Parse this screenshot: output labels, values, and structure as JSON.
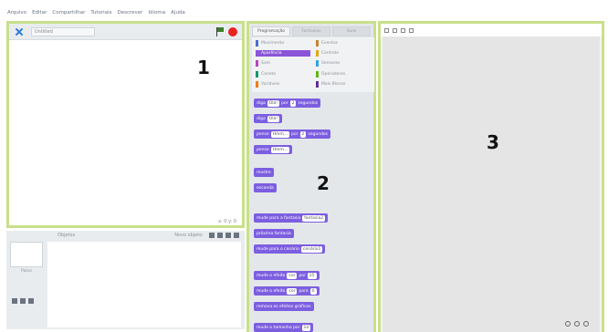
{
  "menubar": {
    "items": [
      "Arquivo",
      "Editar",
      "Compartilhar",
      "Tutoriais",
      "Descrever",
      "Idioma",
      "Ajuda"
    ]
  },
  "region_numbers": {
    "stage": "1",
    "blocks": "2",
    "scripts": "3"
  },
  "stage": {
    "project_title": "Untitled",
    "footer": "x: 0   y: 0"
  },
  "sprites": {
    "title": "Objetos",
    "new_label": "Novo objeto:",
    "stage_label": "Palco"
  },
  "palette": {
    "tabs": [
      "Programação",
      "Fantasias",
      "Sons"
    ],
    "categories": [
      {
        "label": "Movimento",
        "color": "#4a6cd4"
      },
      {
        "label": "Eventos",
        "color": "#c88330"
      },
      {
        "label": "Aparência",
        "color": "#8a55d7",
        "selected": true
      },
      {
        "label": "Controle",
        "color": "#e1a91a"
      },
      {
        "label": "Som",
        "color": "#bb42c3"
      },
      {
        "label": "Sensores",
        "color": "#2ca5e2"
      },
      {
        "label": "Caneta",
        "color": "#0e9a6c"
      },
      {
        "label": "Operadores",
        "color": "#5cb712"
      },
      {
        "label": "Variáveis",
        "color": "#ee7d16"
      },
      {
        "label": "Mais Blocos",
        "color": "#632d99"
      }
    ],
    "blocks": [
      {
        "parts": [
          "diga",
          "Olá!",
          "por",
          "2",
          "segundos"
        ]
      },
      {
        "parts": [
          "diga",
          "Olá!"
        ]
      },
      {
        "parts": [
          "pense",
          "Hmm...",
          "por",
          "2",
          "segundos"
        ]
      },
      {
        "parts": [
          "pense",
          "Hmm..."
        ]
      },
      {
        "parts": [
          "mostre"
        ]
      },
      {
        "parts": [
          "esconda"
        ]
      },
      {
        "parts": [
          "mude para a fantasia",
          "fantasia2"
        ]
      },
      {
        "parts": [
          "próxima fantasia"
        ]
      },
      {
        "parts": [
          "mude para o cenário",
          "cenário1"
        ]
      },
      {
        "parts": [
          "mude o efeito",
          "cor",
          "por",
          "25"
        ]
      },
      {
        "parts": [
          "mude o efeito",
          "cor",
          "para",
          "0"
        ]
      },
      {
        "parts": [
          "remova os efeitos gráficos"
        ]
      },
      {
        "parts": [
          "mude o tamanho por",
          "10"
        ]
      }
    ]
  },
  "colors": {
    "region_border": "#c8e08a",
    "block_purple": "#7c5ee0",
    "stop": "#e8231f",
    "flag": "#3a7f2a"
  }
}
